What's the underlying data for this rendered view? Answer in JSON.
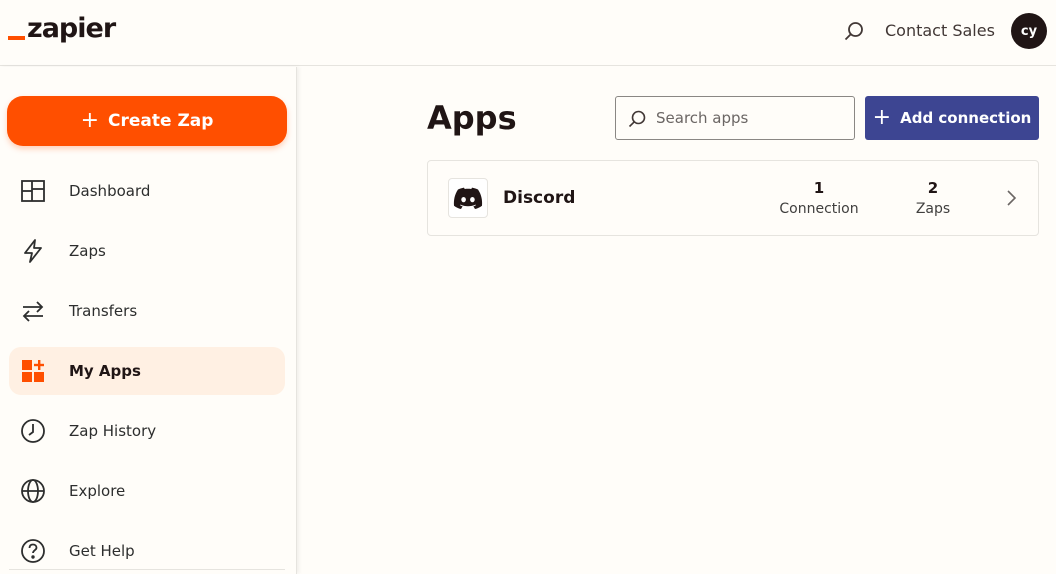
{
  "brand": {
    "logo_text": "zapier",
    "accent": "#ff4f00"
  },
  "header": {
    "contact_sales": "Contact Sales",
    "avatar_initials": "cy",
    "search_icon": "search-icon"
  },
  "sidebar": {
    "create_label": "Create Zap",
    "items": [
      {
        "label": "Dashboard",
        "icon": "dashboard-icon",
        "active": false
      },
      {
        "label": "Zaps",
        "icon": "lightning-icon",
        "active": false
      },
      {
        "label": "Transfers",
        "icon": "transfer-arrows-icon",
        "active": false
      },
      {
        "label": "My Apps",
        "icon": "apps-grid-icon",
        "active": true
      },
      {
        "label": "Zap History",
        "icon": "clock-icon",
        "active": false
      },
      {
        "label": "Explore",
        "icon": "globe-icon",
        "active": false
      },
      {
        "label": "Get Help",
        "icon": "help-circle-icon",
        "active": false
      }
    ]
  },
  "main": {
    "title": "Apps",
    "search": {
      "placeholder": "Search apps",
      "value": ""
    },
    "add_connection_label": "Add connection",
    "apps": [
      {
        "name": "Discord",
        "icon": "discord-icon",
        "connections_count": "1",
        "connections_label": "Connection",
        "zaps_count": "2",
        "zaps_label": "Zaps"
      }
    ]
  },
  "colors": {
    "primary_button": "#3d4592",
    "active_nav_bg": "#fff0e3",
    "text_dark": "#201515"
  }
}
